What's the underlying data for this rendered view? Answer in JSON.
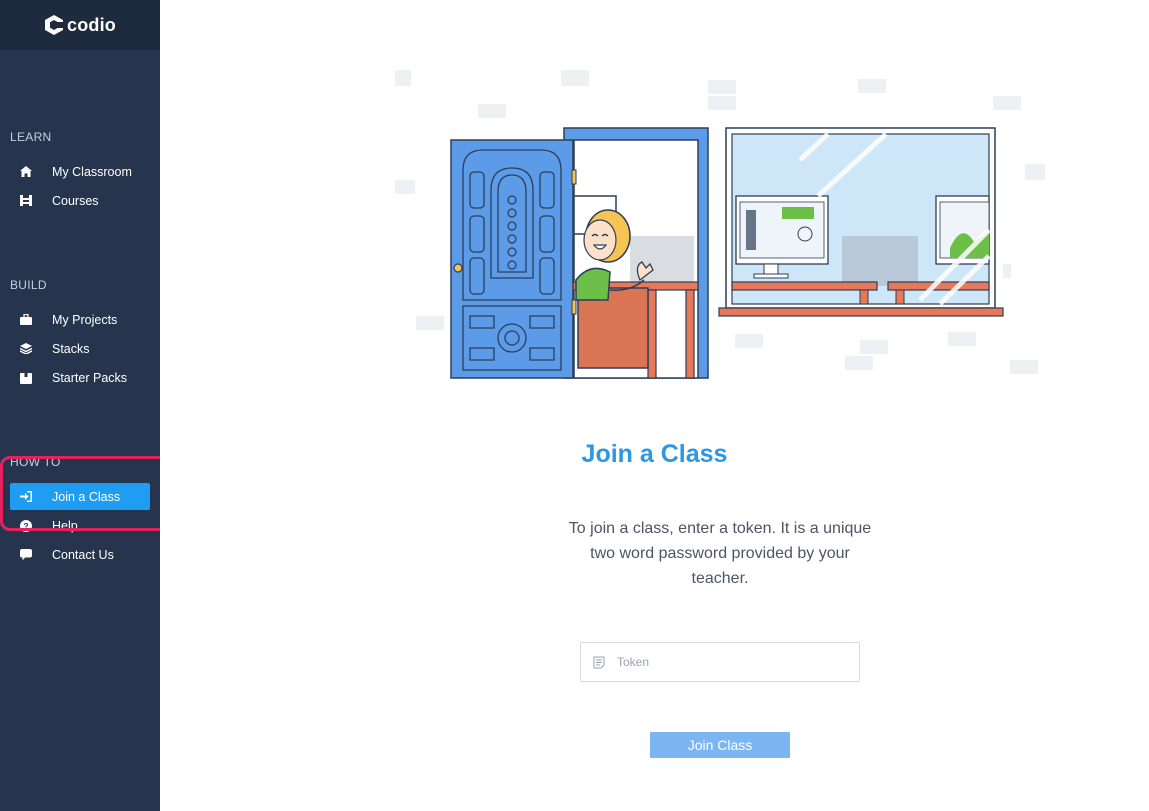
{
  "brand": {
    "name": "codio"
  },
  "sidebar": {
    "sections": [
      {
        "title": "LEARN",
        "items": [
          {
            "label": "My Classroom",
            "icon": "home-icon"
          },
          {
            "label": "Courses",
            "icon": "courses-icon"
          }
        ]
      },
      {
        "title": "BUILD",
        "items": [
          {
            "label": "My Projects",
            "icon": "briefcase-icon"
          },
          {
            "label": "Stacks",
            "icon": "layers-icon"
          },
          {
            "label": "Starter Packs",
            "icon": "box-icon"
          }
        ]
      },
      {
        "title": "HOW TO",
        "items": [
          {
            "label": "Join a Class",
            "icon": "sign-in-icon",
            "active": true
          },
          {
            "label": "Help",
            "icon": "question-circle-icon"
          },
          {
            "label": "Contact Us",
            "icon": "chat-bubble-icon"
          }
        ]
      }
    ]
  },
  "main": {
    "heading": "Join a Class",
    "description": "To join a class, enter a token. It is a unique two word password provided by your teacher.",
    "token": {
      "placeholder": "Token",
      "value": "",
      "icon": "note-icon"
    },
    "join_button": "Join Class"
  },
  "colors": {
    "sidebar_bg": "#26344d",
    "active_item": "#1e9df2",
    "heading": "#2b97e6",
    "button": "#7bb6f2",
    "highlight": "#e6215f"
  }
}
